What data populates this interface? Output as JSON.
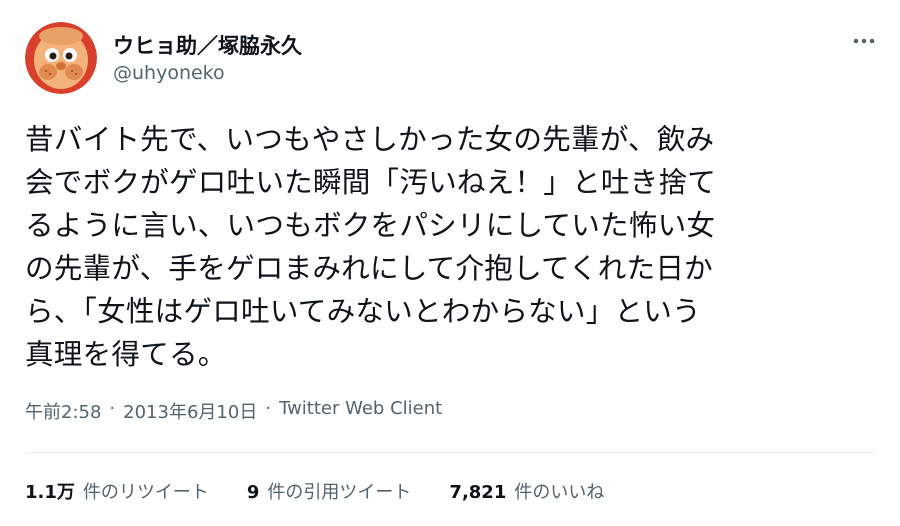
{
  "author": {
    "name": "ウヒョ助／塚脇永久",
    "handle": "@uhyoneko",
    "avatar_icon": "cartoon-face-avatar",
    "avatar_bg": "#d9402b"
  },
  "more_icon": "more-horizontal-icon",
  "tweet": {
    "lines": [
      "昔バイト先で、いつもやさしかった女の先輩が、飲み",
      "会でボクがゲロ吐いた瞬間「汚いねえ！」と吐き捨て",
      "るように言い、いつもボクをパシリにしていた怖い女",
      "の先輩が、手をゲロまみれにして介抱してくれた日か",
      "ら、「女性はゲロ吐いてみないとわからない」という",
      "真理を得てる。"
    ]
  },
  "meta": {
    "time": "午前2:58",
    "separator1": "·",
    "date": "2013年6月10日",
    "separator2": "·",
    "client": "Twitter Web Client"
  },
  "stats": {
    "retweets": {
      "count": "1.1万",
      "label": "件のリツイート"
    },
    "quotes": {
      "count": "9",
      "label": "件の引用ツイート"
    },
    "likes": {
      "count": "7,821",
      "label": "件のいいね"
    }
  }
}
